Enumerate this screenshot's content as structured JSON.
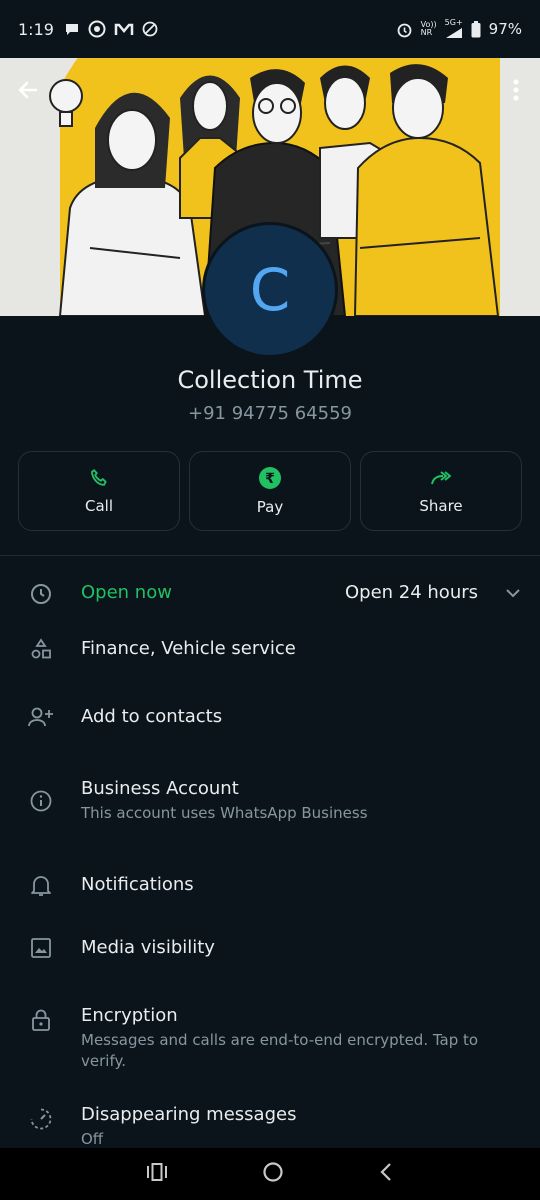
{
  "status_bar": {
    "time": "1:19",
    "net_top": "Vo))",
    "net_bottom": "NR",
    "network_type": "5G+",
    "battery": "97%"
  },
  "cover": {
    "back_icon": "arrow-left-icon",
    "menu_icon": "more-vertical-icon"
  },
  "profile": {
    "avatar_letter": "C",
    "name": "Collection Time",
    "phone": "+91 94775 64559"
  },
  "actions": [
    {
      "label": "Call",
      "icon": "phone-icon"
    },
    {
      "label": "Pay",
      "icon": "rupee-icon"
    },
    {
      "label": "Share",
      "icon": "share-icon"
    }
  ],
  "business_hours": {
    "status": "Open now",
    "hours": "Open 24 hours"
  },
  "category": "Finance, Vehicle service",
  "add_contacts": "Add to contacts",
  "business_account": {
    "title": "Business Account",
    "subtitle": "This account uses WhatsApp Business"
  },
  "notifications": "Notifications",
  "media_visibility": "Media visibility",
  "encryption": {
    "title": "Encryption",
    "subtitle": "Messages and calls are end-to-end encrypted. Tap to verify."
  },
  "disappearing": {
    "title": "Disappearing messages",
    "subtitle": "Off"
  },
  "colors": {
    "accent": "#21c063",
    "background": "#0b141a",
    "avatar_bg": "#0f2f4c",
    "avatar_letter": "#53a6f0"
  }
}
